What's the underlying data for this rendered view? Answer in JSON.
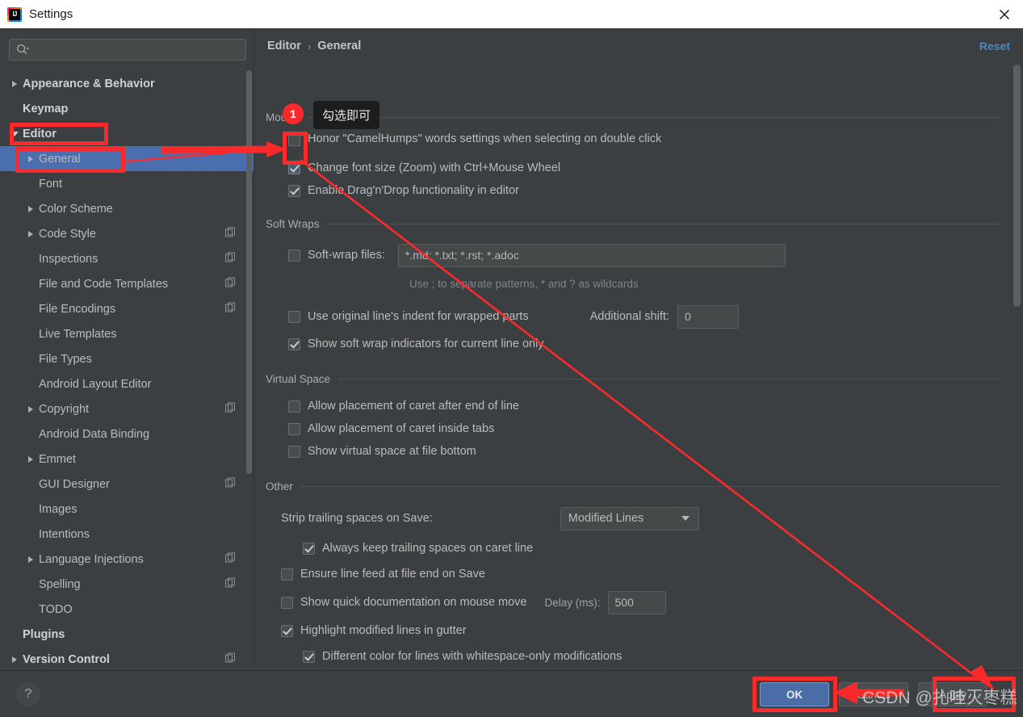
{
  "window": {
    "title": "Settings",
    "app_icon": "intellij-idea-icon",
    "close_icon": "close-icon"
  },
  "sidebar": {
    "search": {
      "placeholder": "",
      "value": "",
      "icon": "search-icon"
    },
    "items": [
      {
        "label": "Appearance & Behavior",
        "indent": 0,
        "arrow": "right",
        "bold": true,
        "copy": false,
        "selected": false
      },
      {
        "label": "Keymap",
        "indent": 0,
        "arrow": "none",
        "bold": true,
        "copy": false,
        "selected": false
      },
      {
        "label": "Editor",
        "indent": 0,
        "arrow": "down",
        "bold": true,
        "copy": false,
        "selected": false
      },
      {
        "label": "General",
        "indent": 1,
        "arrow": "right",
        "bold": false,
        "copy": false,
        "selected": true
      },
      {
        "label": "Font",
        "indent": 1,
        "arrow": "none",
        "bold": false,
        "copy": false,
        "selected": false
      },
      {
        "label": "Color Scheme",
        "indent": 1,
        "arrow": "right",
        "bold": false,
        "copy": false,
        "selected": false
      },
      {
        "label": "Code Style",
        "indent": 1,
        "arrow": "right",
        "bold": false,
        "copy": true,
        "selected": false
      },
      {
        "label": "Inspections",
        "indent": 1,
        "arrow": "none",
        "bold": false,
        "copy": true,
        "selected": false
      },
      {
        "label": "File and Code Templates",
        "indent": 1,
        "arrow": "none",
        "bold": false,
        "copy": true,
        "selected": false
      },
      {
        "label": "File Encodings",
        "indent": 1,
        "arrow": "none",
        "bold": false,
        "copy": true,
        "selected": false
      },
      {
        "label": "Live Templates",
        "indent": 1,
        "arrow": "none",
        "bold": false,
        "copy": false,
        "selected": false
      },
      {
        "label": "File Types",
        "indent": 1,
        "arrow": "none",
        "bold": false,
        "copy": false,
        "selected": false
      },
      {
        "label": "Android Layout Editor",
        "indent": 1,
        "arrow": "none",
        "bold": false,
        "copy": false,
        "selected": false
      },
      {
        "label": "Copyright",
        "indent": 1,
        "arrow": "right",
        "bold": false,
        "copy": true,
        "selected": false
      },
      {
        "label": "Android Data Binding",
        "indent": 1,
        "arrow": "none",
        "bold": false,
        "copy": false,
        "selected": false
      },
      {
        "label": "Emmet",
        "indent": 1,
        "arrow": "right",
        "bold": false,
        "copy": false,
        "selected": false
      },
      {
        "label": "GUI Designer",
        "indent": 1,
        "arrow": "none",
        "bold": false,
        "copy": true,
        "selected": false
      },
      {
        "label": "Images",
        "indent": 1,
        "arrow": "none",
        "bold": false,
        "copy": false,
        "selected": false
      },
      {
        "label": "Intentions",
        "indent": 1,
        "arrow": "none",
        "bold": false,
        "copy": false,
        "selected": false
      },
      {
        "label": "Language Injections",
        "indent": 1,
        "arrow": "right",
        "bold": false,
        "copy": true,
        "selected": false
      },
      {
        "label": "Spelling",
        "indent": 1,
        "arrow": "none",
        "bold": false,
        "copy": true,
        "selected": false
      },
      {
        "label": "TODO",
        "indent": 1,
        "arrow": "none",
        "bold": false,
        "copy": false,
        "selected": false
      },
      {
        "label": "Plugins",
        "indent": 0,
        "arrow": "none",
        "bold": true,
        "copy": false,
        "selected": false
      },
      {
        "label": "Version Control",
        "indent": 0,
        "arrow": "right",
        "bold": true,
        "copy": true,
        "selected": false
      }
    ]
  },
  "content": {
    "breadcrumb": {
      "parent": "Editor",
      "separator": "›",
      "current": "General"
    },
    "reset_label": "Reset",
    "groups": {
      "mouse": {
        "title": "Mouse",
        "options": [
          {
            "label": "Honor \"CamelHumps\" words settings when selecting on double click",
            "checked": false
          },
          {
            "label": "Change font size (Zoom) with Ctrl+Mouse Wheel",
            "checked": true
          },
          {
            "label": "Enable Drag'n'Drop functionality in editor",
            "checked": true
          }
        ]
      },
      "soft_wraps": {
        "title": "Soft Wraps",
        "softwrap_files": {
          "label": "Soft-wrap files:",
          "checked": false,
          "value": "*.md; *.txt; *.rst; *.adoc"
        },
        "hint": "Use ; to separate patterns, * and ? as wildcards",
        "use_original_indent": {
          "label": "Use original line's indent for wrapped parts",
          "checked": false
        },
        "additional_shift": {
          "label": "Additional shift:",
          "value": "0"
        },
        "show_indicators": {
          "label": "Show soft wrap indicators for current line only",
          "checked": true
        }
      },
      "virtual_space": {
        "title": "Virtual Space",
        "options": [
          {
            "label": "Allow placement of caret after end of line",
            "checked": false
          },
          {
            "label": "Allow placement of caret inside tabs",
            "checked": false
          },
          {
            "label": "Show virtual space at file bottom",
            "checked": false
          }
        ]
      },
      "other": {
        "title": "Other",
        "strip_trailing": {
          "label": "Strip trailing spaces on Save:",
          "value": "Modified Lines"
        },
        "always_keep": {
          "label": "Always keep trailing spaces on caret line",
          "checked": true
        },
        "ensure_linefeed": {
          "label": "Ensure line feed at file end on Save",
          "checked": false
        },
        "quick_doc": {
          "label": "Show quick documentation on mouse move",
          "checked": false
        },
        "delay": {
          "label": "Delay (ms):",
          "value": "500"
        },
        "highlight_modified": {
          "label": "Highlight modified lines in gutter",
          "checked": true
        },
        "different_color": {
          "label": "Different color for lines with whitespace-only modifications",
          "checked": true
        }
      }
    }
  },
  "footer": {
    "help_label": "?",
    "ok_label": "OK",
    "cancel_label": "Cancel",
    "apply_label": "Apply"
  },
  "annotations": {
    "step_badge": "1",
    "tooltip": "勾选即可",
    "accent_color": "#fb2a2a",
    "watermark": "CSDN @扎哇灭枣糕"
  }
}
